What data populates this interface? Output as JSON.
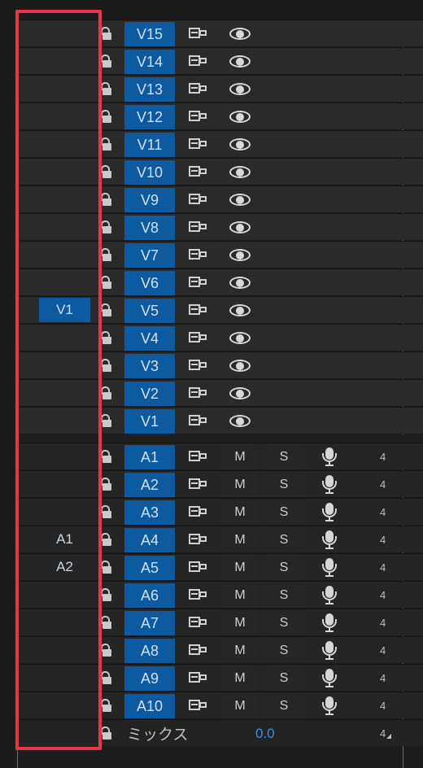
{
  "video_tracks": [
    {
      "name": "V15",
      "source": ""
    },
    {
      "name": "V14",
      "source": ""
    },
    {
      "name": "V13",
      "source": ""
    },
    {
      "name": "V12",
      "source": ""
    },
    {
      "name": "V11",
      "source": ""
    },
    {
      "name": "V10",
      "source": ""
    },
    {
      "name": "V9",
      "source": ""
    },
    {
      "name": "V8",
      "source": ""
    },
    {
      "name": "V7",
      "source": ""
    },
    {
      "name": "V6",
      "source": ""
    },
    {
      "name": "V5",
      "source": "V1"
    },
    {
      "name": "V4",
      "source": ""
    },
    {
      "name": "V3",
      "source": ""
    },
    {
      "name": "V2",
      "source": ""
    },
    {
      "name": "V1",
      "source": ""
    }
  ],
  "audio_tracks": [
    {
      "name": "A1",
      "source": "",
      "mute": "M",
      "solo": "S",
      "channel": "4"
    },
    {
      "name": "A2",
      "source": "",
      "mute": "M",
      "solo": "S",
      "channel": "4"
    },
    {
      "name": "A3",
      "source": "",
      "mute": "M",
      "solo": "S",
      "channel": "4"
    },
    {
      "name": "A4",
      "source": "A1",
      "mute": "M",
      "solo": "S",
      "channel": "4"
    },
    {
      "name": "A5",
      "source": "A2",
      "mute": "M",
      "solo": "S",
      "channel": "4"
    },
    {
      "name": "A6",
      "source": "",
      "mute": "M",
      "solo": "S",
      "channel": "4"
    },
    {
      "name": "A7",
      "source": "",
      "mute": "M",
      "solo": "S",
      "channel": "4"
    },
    {
      "name": "A8",
      "source": "",
      "mute": "M",
      "solo": "S",
      "channel": "4"
    },
    {
      "name": "A9",
      "source": "",
      "mute": "M",
      "solo": "S",
      "channel": "4"
    },
    {
      "name": "A10",
      "source": "",
      "mute": "M",
      "solo": "S",
      "channel": "4"
    }
  ],
  "mix": {
    "label": "ミックス",
    "value": "0.0",
    "channel": "4"
  },
  "icons": {
    "lock": "lock-icon",
    "sync": "sync-lock-icon",
    "eye": "eye-icon",
    "mic": "microphone-icon"
  },
  "colors": {
    "track_badge": "#0d5aa0",
    "highlight": "#e8344d",
    "value": "#3a8ee6",
    "playhead": "#3d74b6"
  }
}
